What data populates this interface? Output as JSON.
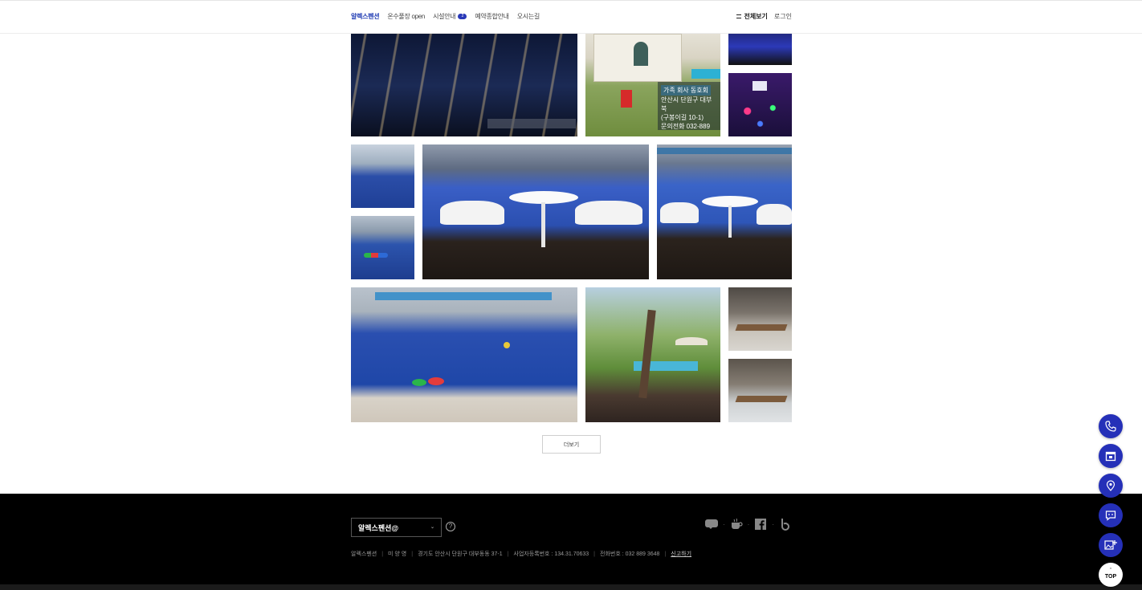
{
  "header": {
    "nav": [
      {
        "label": "알렉스펜션",
        "active": true
      },
      {
        "label": "온수풀장 open",
        "active": false
      },
      {
        "label": "시설안내",
        "active": false,
        "badge": "2"
      },
      {
        "label": "예약종합안내",
        "active": false
      },
      {
        "label": "오시는길",
        "active": false
      }
    ],
    "menu_all_label": "전체보기",
    "login_label": "로그인"
  },
  "gallery": {
    "house_sign_title": "가족 회사 동호회",
    "house_sign_line1": "안산시 단원구 대부북",
    "house_sign_line2": "(구봉이길 10-1)",
    "house_sign_line3": "문의전화 032-889",
    "more_label": "더보기"
  },
  "footer": {
    "select_label": "알렉스펜션@",
    "help_icon": "question-icon",
    "socials": [
      "blog-icon",
      "kakao-story-icon",
      "facebook-icon",
      "band-icon"
    ],
    "info": {
      "company": "알렉스펜션",
      "owner": "미 양 영",
      "address": "경기도 안산시 단원구 대부동동 37-1",
      "business_number": "사업자등록번호 : 134.31.70633",
      "phone": "전화번호 : 032 889 3648",
      "report_link": "신고하기"
    }
  },
  "floating": {
    "buttons": [
      "phone-icon",
      "calendar-icon",
      "location-pin-icon",
      "chat-icon",
      "add-image-icon"
    ],
    "top_label": "TOP",
    "accent": "#2530b8"
  }
}
